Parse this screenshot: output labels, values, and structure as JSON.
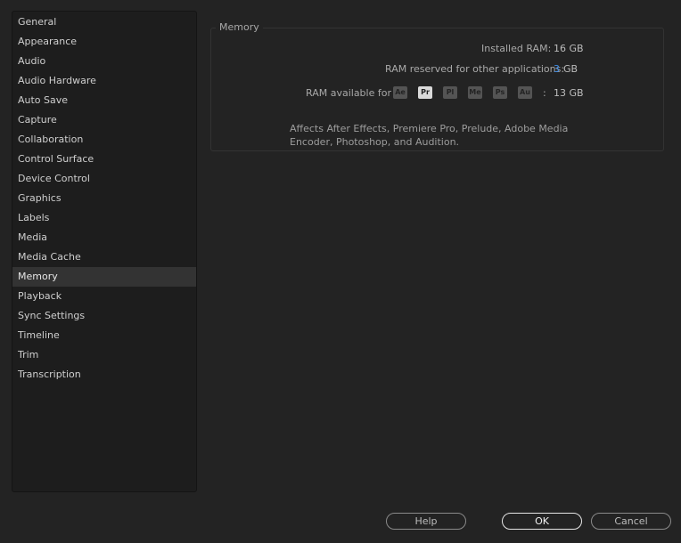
{
  "sidebar": {
    "items": [
      {
        "label": "General"
      },
      {
        "label": "Appearance"
      },
      {
        "label": "Audio"
      },
      {
        "label": "Audio Hardware"
      },
      {
        "label": "Auto Save"
      },
      {
        "label": "Capture"
      },
      {
        "label": "Collaboration"
      },
      {
        "label": "Control Surface"
      },
      {
        "label": "Device Control"
      },
      {
        "label": "Graphics"
      },
      {
        "label": "Labels"
      },
      {
        "label": "Media"
      },
      {
        "label": "Media Cache"
      },
      {
        "label": "Memory"
      },
      {
        "label": "Playback"
      },
      {
        "label": "Sync Settings"
      },
      {
        "label": "Timeline"
      },
      {
        "label": "Trim"
      },
      {
        "label": "Transcription"
      }
    ],
    "selected": "Memory"
  },
  "memory": {
    "group_title": "Memory",
    "installed_label": "Installed RAM:",
    "installed_value": "16 GB",
    "reserved_label": "RAM reserved for other applications:",
    "reserved_value": "3",
    "reserved_unit": "GB",
    "available_label": "RAM available for",
    "apps": [
      {
        "abbr": "Ae",
        "active": false
      },
      {
        "abbr": "Pr",
        "active": true
      },
      {
        "abbr": "Pl",
        "active": false
      },
      {
        "abbr": "Me",
        "active": false
      },
      {
        "abbr": "Ps",
        "active": false
      },
      {
        "abbr": "Au",
        "active": false
      }
    ],
    "available_sep": ":",
    "available_value": "13 GB",
    "note": "Affects After Effects, Premiere Pro, Prelude, Adobe Media Encoder, Photoshop, and Audition."
  },
  "buttons": {
    "help": "Help",
    "ok": "OK",
    "cancel": "Cancel"
  },
  "colors": {
    "accent_value": "#3f8ee8",
    "background": "#232323",
    "sidebar_bg": "#1d1d1d",
    "selected_bg": "#333333"
  }
}
